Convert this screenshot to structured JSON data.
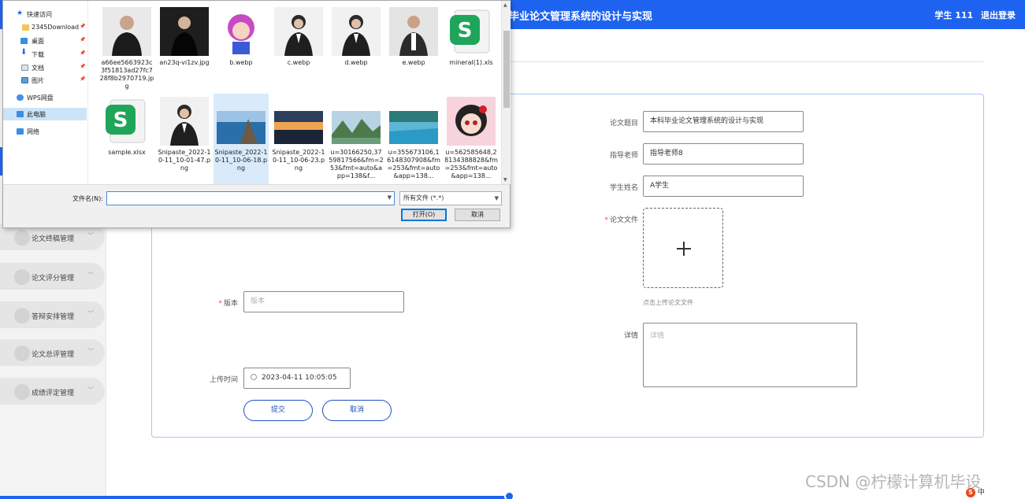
{
  "header": {
    "title": "毕业论文管理系统的设计与实现",
    "user": "学生 111",
    "logout": "退出登录",
    "bg_color": "#1e63f0"
  },
  "sidebar": {
    "items": [
      {
        "label": "论文终稿管理"
      },
      {
        "label": "论文评分管理"
      },
      {
        "label": "答辩安排管理"
      },
      {
        "label": "论文总评管理"
      },
      {
        "label": "成绩评定管理"
      }
    ]
  },
  "form": {
    "title_label": "论文题目",
    "title_value": "本科毕业论文管理系统的设计与实现",
    "teacher_label": "指导老师",
    "teacher_value": "指导老师8",
    "student_label": "学生姓名",
    "student_value": "A学生",
    "file_label": "论文文件",
    "upload_hint": "点击上传论文文件",
    "version_label": "版本",
    "version_placeholder": "版本",
    "detail_label": "详情",
    "detail_placeholder": "详情",
    "time_label": "上传时间",
    "time_value": "2023-04-11 10:05:05",
    "submit": "提交",
    "cancel": "取消"
  },
  "dialog": {
    "nav": [
      {
        "label": "快速访问",
        "icon": "star-icon"
      },
      {
        "label": "2345Download",
        "icon": "folder-icon"
      },
      {
        "label": "桌面",
        "icon": "desktop-icon"
      },
      {
        "label": "下载",
        "icon": "download-icon"
      },
      {
        "label": "文档",
        "icon": "document-icon"
      },
      {
        "label": "图片",
        "icon": "picture-icon"
      },
      {
        "label": "WPS网盘",
        "icon": "cloud-icon"
      },
      {
        "label": "此电脑",
        "icon": "computer-icon"
      },
      {
        "label": "网络",
        "icon": "network-icon"
      }
    ],
    "files": [
      {
        "name": "a66ee5663923c3f51813ad27fc728f8b2970719.jpg",
        "kind": "portrait"
      },
      {
        "name": "an23q-vi1zv.jpg",
        "kind": "portrait-dark"
      },
      {
        "name": "b.webp",
        "kind": "anime"
      },
      {
        "name": "c.webp",
        "kind": "portrait-woman"
      },
      {
        "name": "d.webp",
        "kind": "portrait-woman"
      },
      {
        "name": "e.webp",
        "kind": "portrait-man"
      },
      {
        "name": "mineral(1).xls",
        "kind": "sheet"
      },
      {
        "name": "sample.xlsx",
        "kind": "sheet"
      },
      {
        "name": "Snipaste_2022-10-11_10-01-47.png",
        "kind": "portrait-woman"
      },
      {
        "name": "Snipaste_2022-10-11_10-06-18.png",
        "kind": "lake"
      },
      {
        "name": "Snipaste_2022-10-11_10-06-23.png",
        "kind": "sunset"
      },
      {
        "name": "u=30166250,3759817566&fm=253&fmt=auto&app=138&f...",
        "kind": "hills"
      },
      {
        "name": "u=355673106,16148307908&fm=253&fmt=auto&app=138...",
        "kind": "river"
      },
      {
        "name": "u=562585648,28134388828&fm=253&fmt=auto&app=138...",
        "kind": "anime-girl"
      }
    ],
    "filename_label": "文件名(N):",
    "filename_value": "",
    "filetype": "所有文件 (*.*)",
    "open": "打开(O)",
    "cancel": "取消"
  },
  "watermark": "CSDN @柠檬计算机毕设",
  "tray": {
    "ime": "中"
  }
}
